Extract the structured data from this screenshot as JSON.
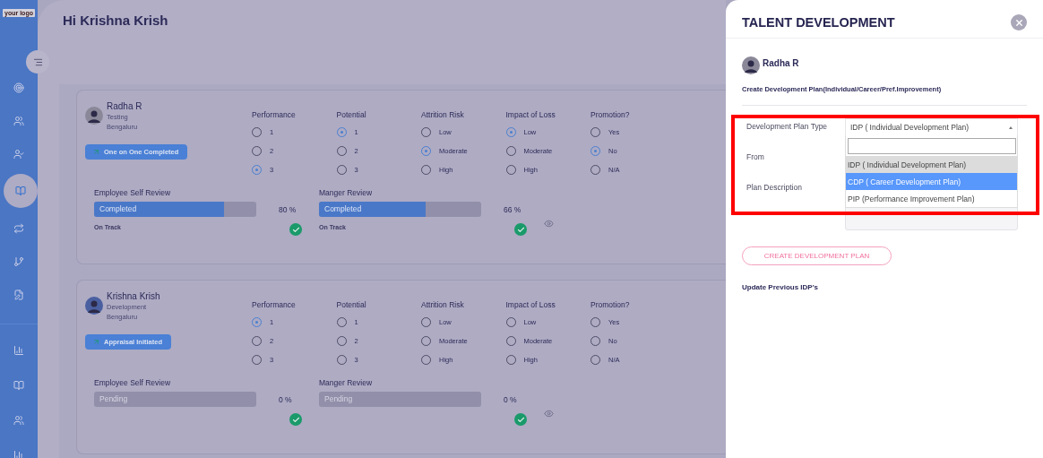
{
  "sidebar": {
    "logo": "your logo",
    "items": [
      {
        "selected": false
      },
      {
        "selected": false
      },
      {
        "selected": false
      },
      {
        "selected": true
      },
      {
        "selected": false
      },
      {
        "selected": false
      },
      {
        "selected": false
      }
    ],
    "bottom_items": [
      {
        "selected": false
      },
      {
        "selected": false
      },
      {
        "selected": false
      },
      {
        "selected": false
      }
    ]
  },
  "greeting": "Hi Krishna Krish",
  "employees": [
    {
      "name": "Radha R",
      "department": "Testing",
      "location": "Bengaluru",
      "status": "One on One Completed",
      "ratings": [
        {
          "title": "Performance",
          "options": [
            {
              "label": "1",
              "selected": false
            },
            {
              "label": "2",
              "selected": false
            },
            {
              "label": "3",
              "selected": true
            }
          ]
        },
        {
          "title": "Potential",
          "options": [
            {
              "label": "1",
              "selected": true
            },
            {
              "label": "2",
              "selected": false
            },
            {
              "label": "3",
              "selected": false
            }
          ]
        },
        {
          "title": "Attrition Risk",
          "options": [
            {
              "label": "Low",
              "selected": false
            },
            {
              "label": "Moderate",
              "selected": true
            },
            {
              "label": "High",
              "selected": false
            }
          ]
        },
        {
          "title": "Impact of Loss",
          "options": [
            {
              "label": "Low",
              "selected": true
            },
            {
              "label": "Moderate",
              "selected": false
            },
            {
              "label": "High",
              "selected": false
            }
          ]
        },
        {
          "title": "Promotion?",
          "options": [
            {
              "label": "Yes",
              "selected": false
            },
            {
              "label": "No",
              "selected": true
            },
            {
              "label": "N/A",
              "selected": false
            }
          ]
        }
      ],
      "reviews": [
        {
          "title": "Employee Self Review",
          "status": "Completed",
          "level": 0.8,
          "percent": "80 %",
          "track": "On Track",
          "done": true
        },
        {
          "title": "Manger Review",
          "status": "Completed",
          "level": 0.66,
          "percent": "66 %",
          "track": "On Track",
          "done": true
        }
      ]
    },
    {
      "name": "Krishna Krish",
      "department": "Development",
      "location": "Bengaluru",
      "status": "Appraisal Initiated",
      "ratings": [
        {
          "title": "Performance",
          "options": [
            {
              "label": "1",
              "selected": true
            },
            {
              "label": "2",
              "selected": false
            },
            {
              "label": "3",
              "selected": false
            }
          ]
        },
        {
          "title": "Potential",
          "options": [
            {
              "label": "1",
              "selected": false
            },
            {
              "label": "2",
              "selected": false
            },
            {
              "label": "3",
              "selected": false
            }
          ]
        },
        {
          "title": "Attrition Risk",
          "options": [
            {
              "label": "Low",
              "selected": false
            },
            {
              "label": "Moderate",
              "selected": false
            },
            {
              "label": "High",
              "selected": false
            }
          ]
        },
        {
          "title": "Impact of Loss",
          "options": [
            {
              "label": "Low",
              "selected": false
            },
            {
              "label": "Moderate",
              "selected": false
            },
            {
              "label": "High",
              "selected": false
            }
          ]
        },
        {
          "title": "Promotion?",
          "options": [
            {
              "label": "Yes",
              "selected": false
            },
            {
              "label": "No",
              "selected": false
            },
            {
              "label": "N/A",
              "selected": false
            }
          ]
        }
      ],
      "reviews": [
        {
          "title": "Employee Self Review",
          "status": "Pending",
          "level": 0,
          "percent": "0 %",
          "done": true
        },
        {
          "title": "Manger Review",
          "status": "Pending",
          "level": 0,
          "percent": "0 %",
          "done": true
        }
      ]
    }
  ],
  "panel": {
    "title": "TALENT DEVELOPMENT",
    "employee_name": "Radha R",
    "section_title": "Create Development Plan(Individual/Career/Pref.Improvement)",
    "fields": [
      {
        "label": "Development Plan Type"
      },
      {
        "label": "From"
      },
      {
        "label": "Plan Description"
      }
    ],
    "plan_type": {
      "value": "IDP ( Individual Development Plan)",
      "expanded": true,
      "options": [
        {
          "label": "IDP ( Individual Development Plan)",
          "selected": true,
          "highlighted": false
        },
        {
          "label": "CDP ( Career Development Plan)",
          "selected": false,
          "highlighted": true
        },
        {
          "label": "PIP (Performance Improvement Plan)",
          "selected": false,
          "highlighted": false
        }
      ]
    },
    "button": "CREATE DEVELOPMENT PLAN",
    "footer_link": "Update Previous IDP's"
  }
}
